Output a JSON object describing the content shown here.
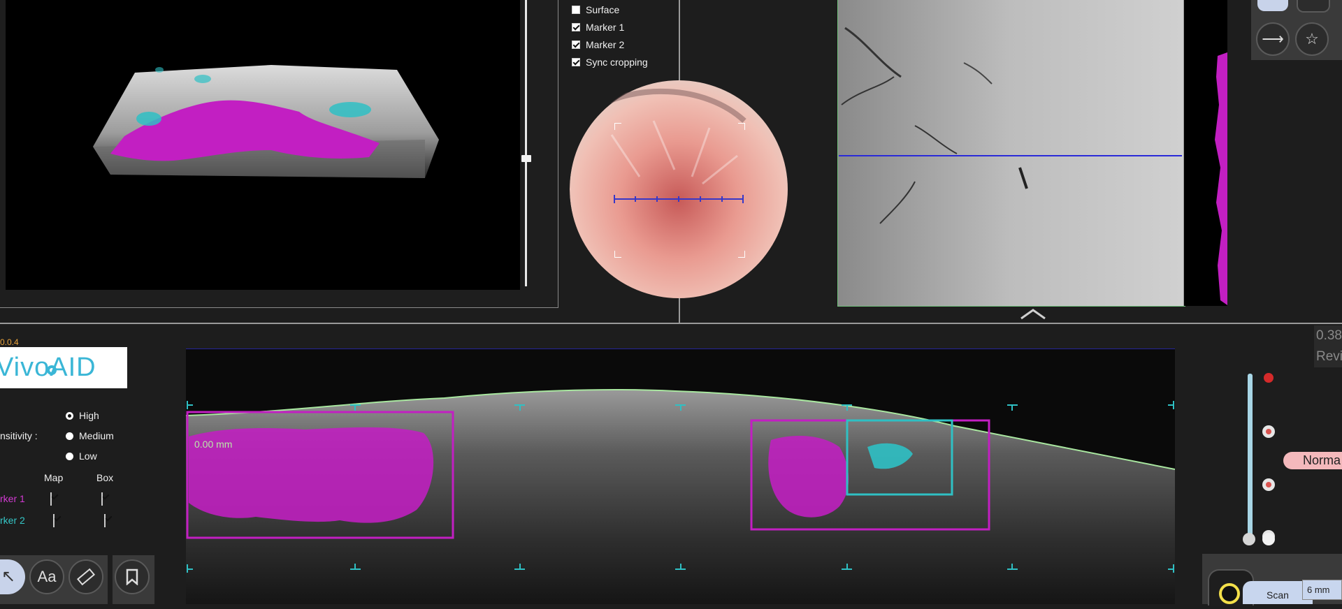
{
  "options": [
    {
      "label": "Surface",
      "checked": false
    },
    {
      "label": "Marker 1",
      "checked": true
    },
    {
      "label": "Marker 2",
      "checked": true
    },
    {
      "label": "Sync cropping",
      "checked": true
    }
  ],
  "version": "0.0.4",
  "logo": {
    "text": "VivoAID"
  },
  "sensitivity": {
    "label": "nsitivity :",
    "levels": [
      {
        "label": "High",
        "selected": true
      },
      {
        "label": "Medium",
        "selected": false
      },
      {
        "label": "Low",
        "selected": false
      }
    ]
  },
  "marker_table": {
    "col_map": "Map",
    "col_box": "Box",
    "rows": [
      {
        "label": "rker 1",
        "color": "#d23ad2",
        "map": true,
        "box": true
      },
      {
        "label": "rker 2",
        "color": "#35c7c7",
        "map": true,
        "box": true
      }
    ]
  },
  "bscan": {
    "depth_label": "0.00 mm"
  },
  "toolbar": {
    "text_tool_label": "Aa"
  },
  "right_panel": {
    "value_partial": "0.38",
    "review_partial": "Revi",
    "classification": "Norma",
    "scan_label": "Scan",
    "scan_length": "6 mm"
  },
  "colors": {
    "marker1": "#c21fc2",
    "marker2": "#2fc0c4",
    "scan_line": "#2a2ad8",
    "frame_green": "#6fbf7a",
    "classification_pill": "#f4b9bc"
  }
}
